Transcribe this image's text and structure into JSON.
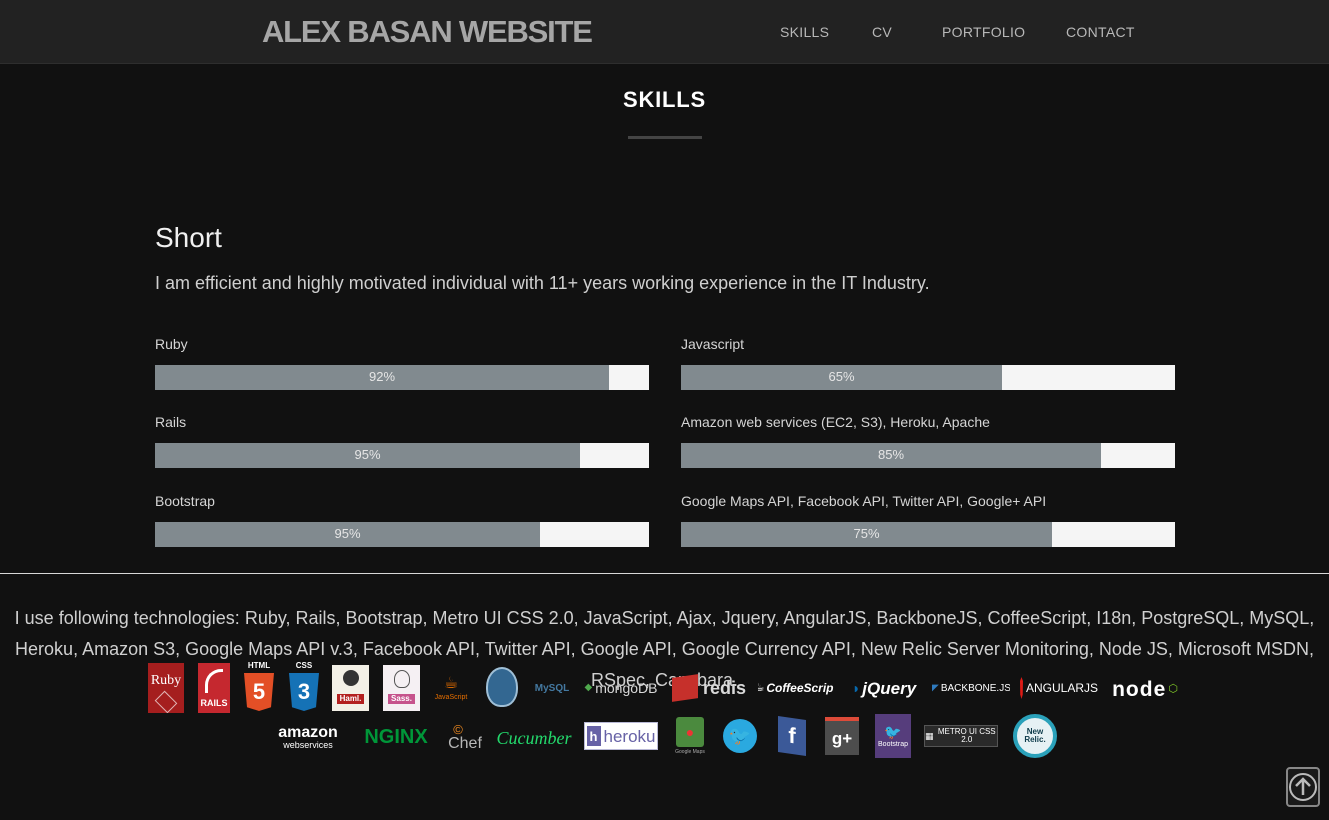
{
  "brand": "ALEX BASAN WEBSITE",
  "nav": {
    "skills": "SKILLS",
    "cv": "CV",
    "portfolio": "PORTFOLIO",
    "contact": "CONTACT"
  },
  "section": {
    "title": "SKILLS",
    "short_heading": "Short",
    "short_text": "I am efficient and highly motivated individual with 11+ years working experience in the IT Industry."
  },
  "skills": [
    {
      "name": "Ruby",
      "percent": 92,
      "label": "92%"
    },
    {
      "name": "Javascript",
      "percent": 65,
      "label": "65%"
    },
    {
      "name": "Rails",
      "percent": 86,
      "label": "95%"
    },
    {
      "name": "Amazon web services (EC2, S3), Heroku, Apache",
      "percent": 85,
      "label": "85%"
    },
    {
      "name": "Bootstrap",
      "percent": 78,
      "label": "95%"
    },
    {
      "name": "Google Maps API, Facebook API, Twitter API, Google+ API",
      "percent": 75,
      "label": "75%"
    }
  ],
  "technologies_text": "I use following technologies: Ruby, Rails, Bootstrap, Metro UI CSS 2.0, JavaScript, Ajax, Jquery, AngularJS, BackboneJS, CoffeeScript, I18n, PostgreSQL, MySQL, Heroku, Amazon S3, Google Maps API v.3, Facebook API, Twitter API, Google API, Google Currency API, New Relic Server Monitoring, Node JS, Microsoft MSDN, RSpec, Capybara.",
  "logos": {
    "ruby": "Ruby",
    "rails": "RAILS",
    "html5_top": "HTML",
    "html5_num": "5",
    "css3_top": "CSS",
    "css3_num": "3",
    "haml": "Haml.",
    "sass": "Sass.",
    "javascript": "JavaScript",
    "mysql": "MySQL",
    "mongodb": "mongoDB",
    "redis": "redis",
    "coffeescript": "CoffeeScript",
    "jquery": "jQuery",
    "backbone": "BACKBONE.JS",
    "angular": "ANGULARJS",
    "node": "node",
    "amazon_a": "amazon",
    "amazon_b": "webservices",
    "nginx": "NGINX",
    "chef": "Chef",
    "cucumber": "Cucumber",
    "heroku": "heroku",
    "googlemaps": "Google Maps",
    "bootstrap": "Bootstrap",
    "metro": "METRO UI CSS 2.0",
    "newrelic": "New Relic."
  },
  "colors": {
    "bar_fill": "#818a8f",
    "bar_track": "#f5f5f5",
    "background": "#111111",
    "navbar": "#222222"
  }
}
